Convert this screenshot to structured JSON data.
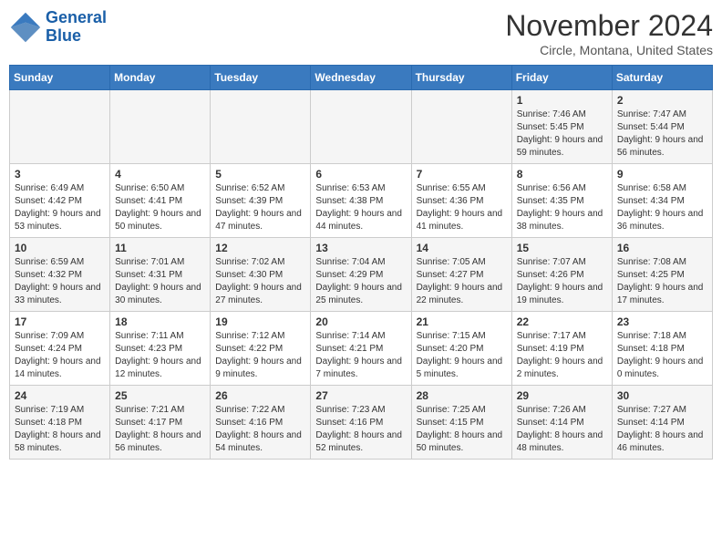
{
  "logo": {
    "line1": "General",
    "line2": "Blue"
  },
  "title": "November 2024",
  "subtitle": "Circle, Montana, United States",
  "weekdays": [
    "Sunday",
    "Monday",
    "Tuesday",
    "Wednesday",
    "Thursday",
    "Friday",
    "Saturday"
  ],
  "weeks": [
    [
      {
        "day": "",
        "info": ""
      },
      {
        "day": "",
        "info": ""
      },
      {
        "day": "",
        "info": ""
      },
      {
        "day": "",
        "info": ""
      },
      {
        "day": "",
        "info": ""
      },
      {
        "day": "1",
        "info": "Sunrise: 7:46 AM\nSunset: 5:45 PM\nDaylight: 9 hours and 59 minutes."
      },
      {
        "day": "2",
        "info": "Sunrise: 7:47 AM\nSunset: 5:44 PM\nDaylight: 9 hours and 56 minutes."
      }
    ],
    [
      {
        "day": "3",
        "info": "Sunrise: 6:49 AM\nSunset: 4:42 PM\nDaylight: 9 hours and 53 minutes."
      },
      {
        "day": "4",
        "info": "Sunrise: 6:50 AM\nSunset: 4:41 PM\nDaylight: 9 hours and 50 minutes."
      },
      {
        "day": "5",
        "info": "Sunrise: 6:52 AM\nSunset: 4:39 PM\nDaylight: 9 hours and 47 minutes."
      },
      {
        "day": "6",
        "info": "Sunrise: 6:53 AM\nSunset: 4:38 PM\nDaylight: 9 hours and 44 minutes."
      },
      {
        "day": "7",
        "info": "Sunrise: 6:55 AM\nSunset: 4:36 PM\nDaylight: 9 hours and 41 minutes."
      },
      {
        "day": "8",
        "info": "Sunrise: 6:56 AM\nSunset: 4:35 PM\nDaylight: 9 hours and 38 minutes."
      },
      {
        "day": "9",
        "info": "Sunrise: 6:58 AM\nSunset: 4:34 PM\nDaylight: 9 hours and 36 minutes."
      }
    ],
    [
      {
        "day": "10",
        "info": "Sunrise: 6:59 AM\nSunset: 4:32 PM\nDaylight: 9 hours and 33 minutes."
      },
      {
        "day": "11",
        "info": "Sunrise: 7:01 AM\nSunset: 4:31 PM\nDaylight: 9 hours and 30 minutes."
      },
      {
        "day": "12",
        "info": "Sunrise: 7:02 AM\nSunset: 4:30 PM\nDaylight: 9 hours and 27 minutes."
      },
      {
        "day": "13",
        "info": "Sunrise: 7:04 AM\nSunset: 4:29 PM\nDaylight: 9 hours and 25 minutes."
      },
      {
        "day": "14",
        "info": "Sunrise: 7:05 AM\nSunset: 4:27 PM\nDaylight: 9 hours and 22 minutes."
      },
      {
        "day": "15",
        "info": "Sunrise: 7:07 AM\nSunset: 4:26 PM\nDaylight: 9 hours and 19 minutes."
      },
      {
        "day": "16",
        "info": "Sunrise: 7:08 AM\nSunset: 4:25 PM\nDaylight: 9 hours and 17 minutes."
      }
    ],
    [
      {
        "day": "17",
        "info": "Sunrise: 7:09 AM\nSunset: 4:24 PM\nDaylight: 9 hours and 14 minutes."
      },
      {
        "day": "18",
        "info": "Sunrise: 7:11 AM\nSunset: 4:23 PM\nDaylight: 9 hours and 12 minutes."
      },
      {
        "day": "19",
        "info": "Sunrise: 7:12 AM\nSunset: 4:22 PM\nDaylight: 9 hours and 9 minutes."
      },
      {
        "day": "20",
        "info": "Sunrise: 7:14 AM\nSunset: 4:21 PM\nDaylight: 9 hours and 7 minutes."
      },
      {
        "day": "21",
        "info": "Sunrise: 7:15 AM\nSunset: 4:20 PM\nDaylight: 9 hours and 5 minutes."
      },
      {
        "day": "22",
        "info": "Sunrise: 7:17 AM\nSunset: 4:19 PM\nDaylight: 9 hours and 2 minutes."
      },
      {
        "day": "23",
        "info": "Sunrise: 7:18 AM\nSunset: 4:18 PM\nDaylight: 9 hours and 0 minutes."
      }
    ],
    [
      {
        "day": "24",
        "info": "Sunrise: 7:19 AM\nSunset: 4:18 PM\nDaylight: 8 hours and 58 minutes."
      },
      {
        "day": "25",
        "info": "Sunrise: 7:21 AM\nSunset: 4:17 PM\nDaylight: 8 hours and 56 minutes."
      },
      {
        "day": "26",
        "info": "Sunrise: 7:22 AM\nSunset: 4:16 PM\nDaylight: 8 hours and 54 minutes."
      },
      {
        "day": "27",
        "info": "Sunrise: 7:23 AM\nSunset: 4:16 PM\nDaylight: 8 hours and 52 minutes."
      },
      {
        "day": "28",
        "info": "Sunrise: 7:25 AM\nSunset: 4:15 PM\nDaylight: 8 hours and 50 minutes."
      },
      {
        "day": "29",
        "info": "Sunrise: 7:26 AM\nSunset: 4:14 PM\nDaylight: 8 hours and 48 minutes."
      },
      {
        "day": "30",
        "info": "Sunrise: 7:27 AM\nSunset: 4:14 PM\nDaylight: 8 hours and 46 minutes."
      }
    ]
  ]
}
